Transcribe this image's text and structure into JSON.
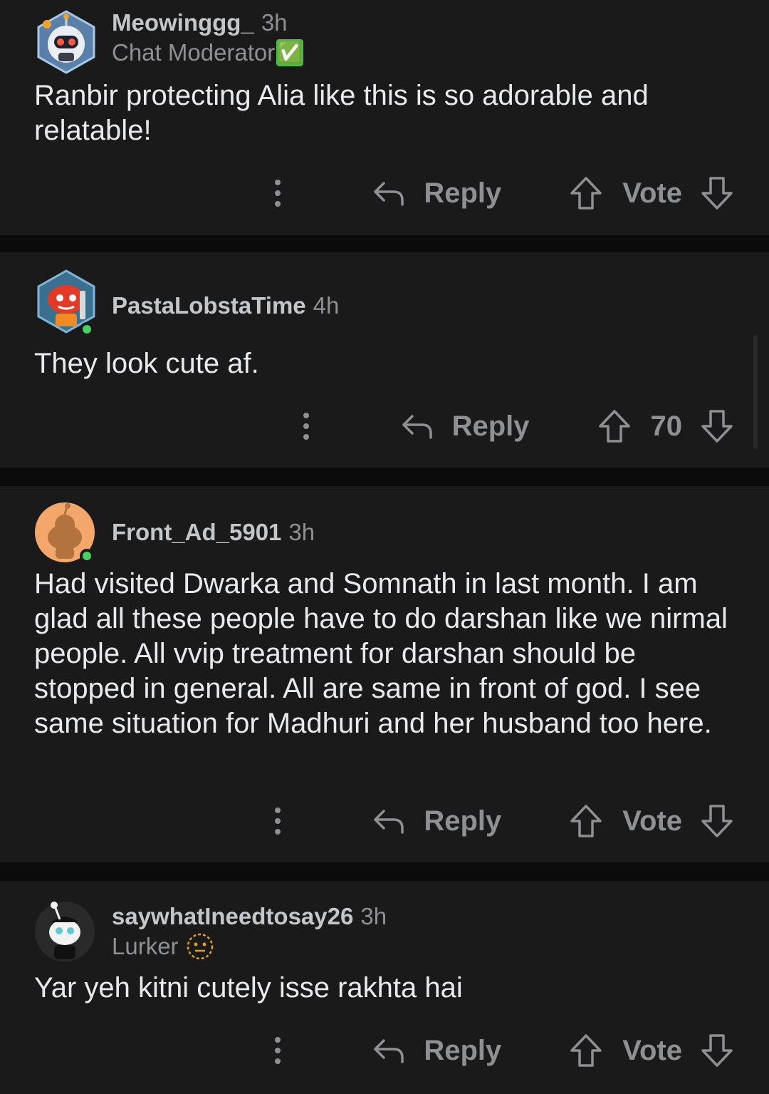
{
  "comments": [
    {
      "username": "Meowinggg_",
      "time": "3h",
      "flair": "Chat Moderator",
      "flair_badge": "✅",
      "text": "Ranbir protecting Alia like this is so adorable and relatable!",
      "reply_label": "Reply",
      "vote_label": "Vote",
      "avatar": "robot-snoo-avatar",
      "online": false
    },
    {
      "username": "PastaLobstaTime",
      "time": "4h",
      "text": "They look cute af.",
      "reply_label": "Reply",
      "vote_label": "70",
      "avatar": "red-snoo-avatar",
      "online": true
    },
    {
      "username": "Front_Ad_5901",
      "time": "3h",
      "text": "Had visited Dwarka and Somnath in last month. I am glad all these people have to do darshan like we nirmal people. All vvip treatment for darshan should be stopped in general. All are same in front of god. I see same situation for Madhuri and her husband too here.",
      "reply_label": "Reply",
      "vote_label": "Vote",
      "avatar": "default-orange-snoo-avatar",
      "online": true
    },
    {
      "username": "saywhatIneedtosay26",
      "time": "3h",
      "flair": "Lurker",
      "flair_icon": "neutral-face-icon",
      "text": "Yar yeh kitni cutely isse rakhta hai",
      "reply_label": "Reply",
      "vote_label": "Vote",
      "avatar": "bw-snoo-avatar",
      "online": false
    }
  ],
  "colors": {
    "background": "#0b0b0b",
    "card": "#1a1a1b",
    "text": "#e8eaed",
    "muted": "#8e9093",
    "online": "#46d160"
  }
}
